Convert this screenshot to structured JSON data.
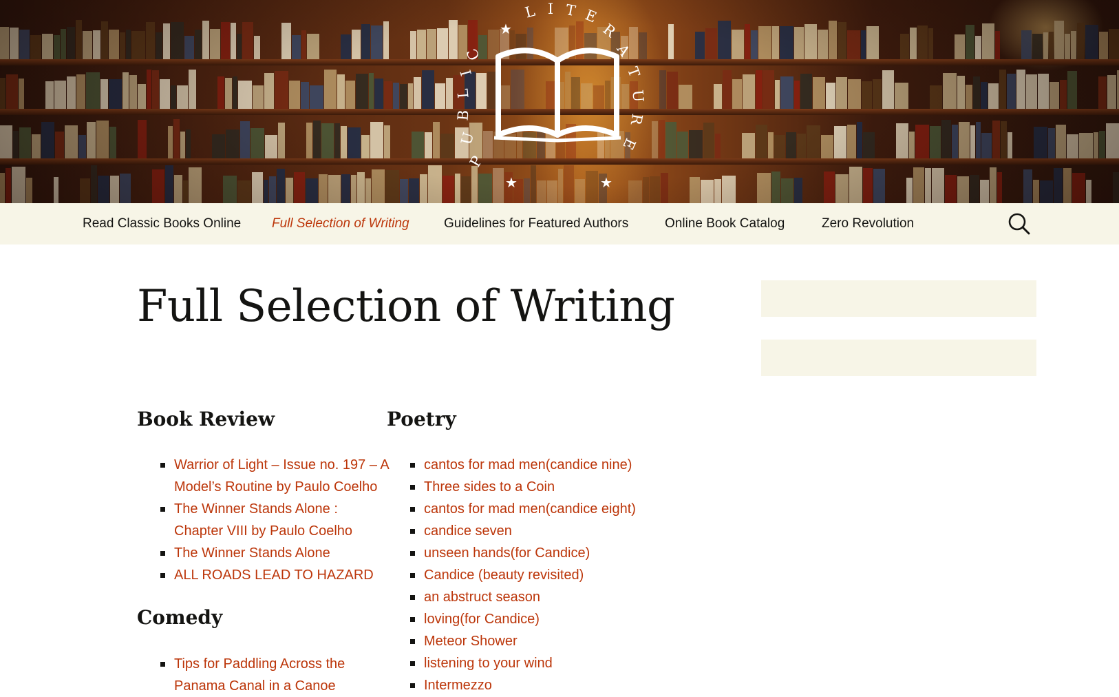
{
  "site": {
    "logo_text": "PUBLIC LITERATURE"
  },
  "nav": {
    "items": [
      {
        "label": "Read Classic Books Online",
        "current": false
      },
      {
        "label": "Full Selection of Writing",
        "current": true
      },
      {
        "label": "Guidelines for Featured Authors",
        "current": false
      },
      {
        "label": "Online Book Catalog",
        "current": false
      },
      {
        "label": "Zero Revolution",
        "current": false
      }
    ],
    "search_icon": "search-icon"
  },
  "page": {
    "title": "Full Selection of Writing"
  },
  "sections": {
    "book_review": {
      "heading": "Book Review",
      "items": [
        "Warrior of Light – Issue no. 197 – A Model’s Routine by Paulo Coelho",
        "The Winner Stands Alone : Chapter VIII by Paulo Coelho",
        "The Winner Stands Alone",
        "ALL ROADS LEAD TO HAZARD"
      ]
    },
    "comedy": {
      "heading": "Comedy",
      "items": [
        "Tips for Paddling Across the Panama Canal in a Canoe"
      ]
    },
    "poetry": {
      "heading": "Poetry",
      "items": [
        "cantos for mad men(candice nine)",
        "Three sides to a Coin",
        "cantos for mad men(candice eight)",
        "candice seven",
        "unseen hands(for Candice)",
        "Candice (beauty revisited)",
        "an abstruct season",
        "loving(for Candice)",
        "Meteor Shower",
        "listening to your wind",
        "Intermezzo"
      ]
    }
  },
  "colors": {
    "link": "#bc360a",
    "nav_bg": "#f7f5e7",
    "text": "#141412"
  }
}
